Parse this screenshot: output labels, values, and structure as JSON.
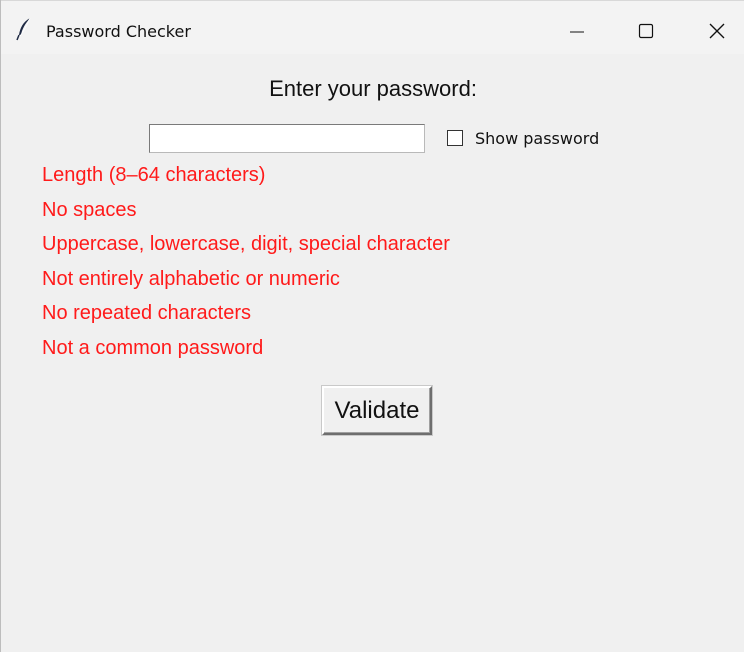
{
  "window": {
    "title": "Password Checker",
    "app_icon": "feather-icon",
    "controls": [
      "minimize-icon",
      "maximize-icon",
      "close-icon"
    ]
  },
  "form": {
    "prompt": "Enter your password:",
    "password_value": "",
    "show_password_label": "Show password",
    "show_password_checked": false
  },
  "rules": [
    "Length (8–64 characters)",
    "No spaces",
    "Uppercase, lowercase, digit, special character",
    "Not entirely alphabetic or numeric",
    "No repeated characters",
    "Not a common password"
  ],
  "rule_color": "#ff1a1a",
  "actions": {
    "validate_label": "Validate"
  }
}
